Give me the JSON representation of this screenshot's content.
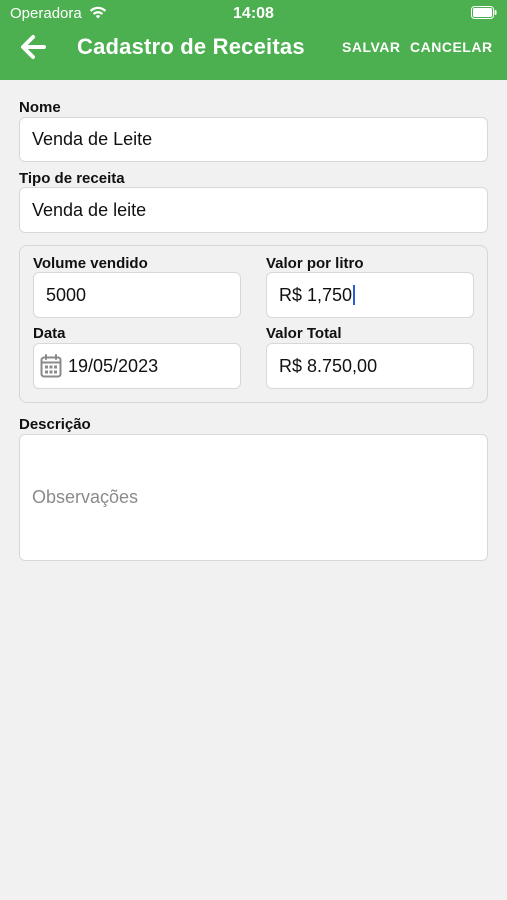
{
  "status_bar": {
    "carrier": "Operadora",
    "time": "14:08",
    "wifi_icon": "wifi-icon",
    "battery_icon": "battery-icon"
  },
  "header": {
    "back_icon": "arrow-left-icon",
    "title": "Cadastro de Receitas",
    "save_label": "SALVAR",
    "cancel_label": "CANCELAR",
    "color": "#4caf50"
  },
  "form": {
    "nome": {
      "label": "Nome",
      "value": "Venda de Leite"
    },
    "tipo": {
      "label": "Tipo de receita",
      "value": "Venda de leite"
    },
    "volume": {
      "label": "Volume vendido",
      "value": "5000"
    },
    "valor_litro": {
      "label": "Valor por litro",
      "value": "R$ 1,750"
    },
    "data": {
      "label": "Data",
      "value": "19/05/2023",
      "icon": "calendar-icon"
    },
    "valor_total": {
      "label": "Valor Total",
      "value": "R$ 8.750,00"
    },
    "descricao": {
      "label": "Descrição",
      "placeholder": "Observações",
      "value": ""
    }
  }
}
